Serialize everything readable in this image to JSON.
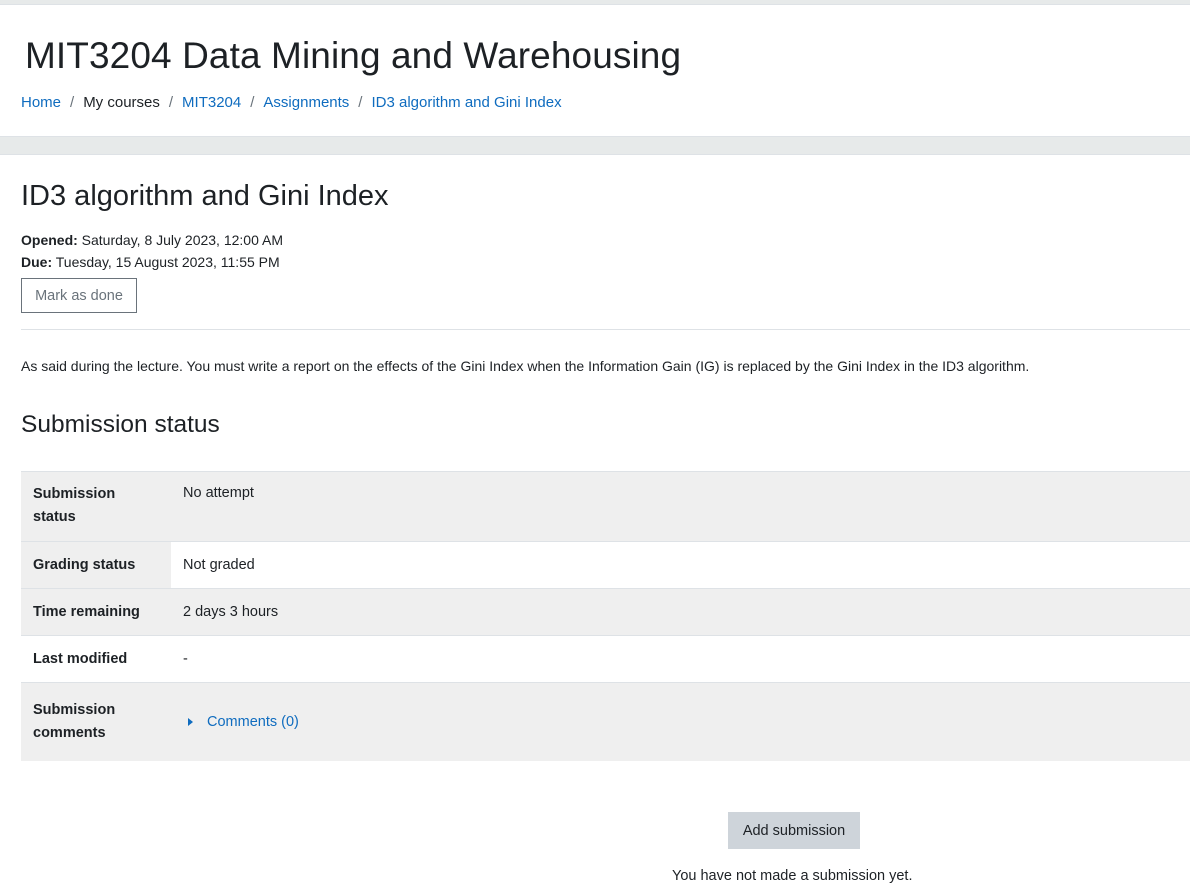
{
  "course": {
    "title": "MIT3204 Data Mining and Warehousing"
  },
  "breadcrumb": {
    "home": "Home",
    "my_courses": "My courses",
    "course": "MIT3204",
    "section": "Assignments",
    "activity": "ID3 algorithm and Gini Index",
    "separator": "/"
  },
  "activity": {
    "title": "ID3 algorithm and Gini Index",
    "opened_label": "Opened:",
    "opened_value": "Saturday, 8 July 2023, 12:00 AM",
    "due_label": "Due:",
    "due_value": "Tuesday, 15 August 2023, 11:55 PM",
    "mark_done_label": "Mark as done",
    "intro": "As said during the lecture. You must write a report on the effects of the Gini Index when the Information Gain (IG) is replaced by the Gini Index in the ID3 algorithm."
  },
  "submission": {
    "heading": "Submission status",
    "rows": [
      {
        "label": "Submission status",
        "value": "No attempt"
      },
      {
        "label": "Grading status",
        "value": "Not graded"
      },
      {
        "label": "Time remaining",
        "value": "2 days 3 hours"
      },
      {
        "label": "Last modified",
        "value": "-"
      },
      {
        "label": "Submission comments",
        "value": "Comments (0)"
      }
    ],
    "add_button": "Add submission",
    "no_submission_note": "You have not made a submission yet."
  },
  "colors": {
    "link": "#0f6cbf",
    "row_shade": "#efefef",
    "button_secondary": "#ced4da"
  },
  "icons": {
    "comments_toggle": "caret-right-icon"
  }
}
